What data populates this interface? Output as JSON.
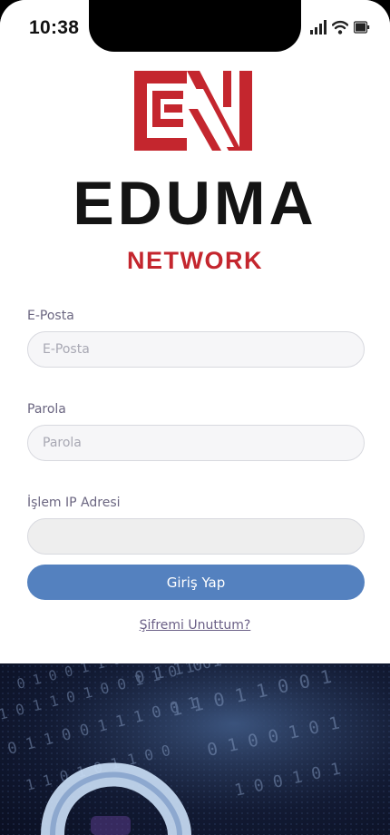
{
  "status_bar": {
    "time": "10:38"
  },
  "logo": {
    "brand": "EDUMA",
    "sub": "NETWORK",
    "brand_color": "#141414",
    "accent_color": "#c4262e"
  },
  "form": {
    "email": {
      "label": "E-Posta",
      "placeholder": "E-Posta",
      "value": ""
    },
    "password": {
      "label": "Parola",
      "placeholder": "Parola",
      "value": ""
    },
    "ip": {
      "label": "İşlem IP Adresi",
      "placeholder": "",
      "value": ""
    },
    "submit_label": "Giriş Yap",
    "forgot_label": "Şifremi Unuttum?"
  },
  "colors": {
    "button": "#5481bf",
    "link": "#6a5f86",
    "label": "#6b6681"
  },
  "icons": [
    "signal-icon",
    "wifi-icon",
    "battery-icon",
    "eduma-logo-icon"
  ]
}
